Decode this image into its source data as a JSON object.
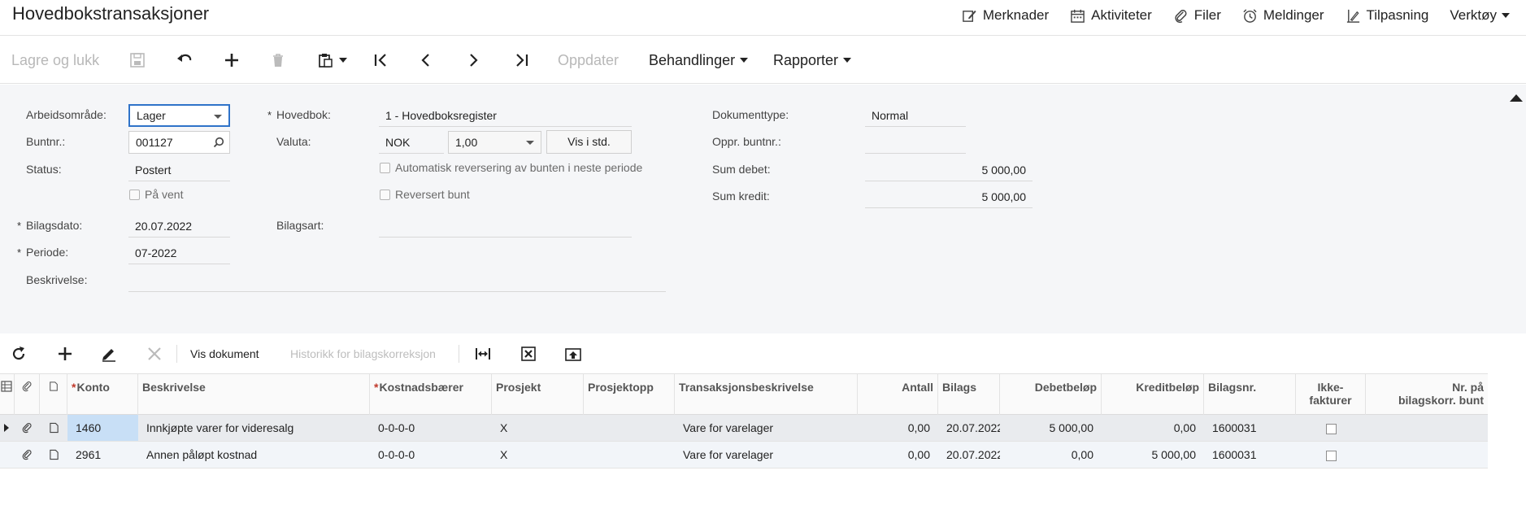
{
  "header": {
    "title": "Hovedbokstransaksjoner",
    "links": [
      {
        "label": "Merknader",
        "icon": "note-edit-icon"
      },
      {
        "label": "Aktiviteter",
        "icon": "calendar-icon"
      },
      {
        "label": "Filer",
        "icon": "paperclip-icon"
      },
      {
        "label": "Meldinger",
        "icon": "alarm-clock-icon"
      },
      {
        "label": "Tilpasning",
        "icon": "customize-icon"
      },
      {
        "label": "Verktøy",
        "icon": "chevron-down-icon"
      }
    ]
  },
  "toolbar": {
    "save_close": "Lagre og lukk",
    "update": "Oppdater",
    "actions": "Behandlinger",
    "reports": "Rapporter"
  },
  "form": {
    "workspace": {
      "label": "Arbeidsområde:",
      "value": "Lager"
    },
    "batch_no": {
      "label": "Buntnr.:",
      "value": "001127"
    },
    "status": {
      "label": "Status:",
      "value": "Postert"
    },
    "on_hold": {
      "label": "På vent"
    },
    "doc_date": {
      "label": "Bilagsdato:",
      "value": "20.07.2022"
    },
    "period": {
      "label": "Periode:",
      "value": "07-2022"
    },
    "description": {
      "label": "Beskrivelse:",
      "value": ""
    },
    "ledger": {
      "label": "Hovedbok:",
      "value": "1 - Hovedboksregister"
    },
    "currency": {
      "label": "Valuta:",
      "value": "NOK",
      "rate": "1,00",
      "button": "Vis i std."
    },
    "auto_reverse": {
      "label": "Automatisk reversering av bunten i neste periode"
    },
    "reversed_batch": {
      "label": "Reversert bunt"
    },
    "doc_type_field": {
      "label": "Bilagsart:",
      "value": ""
    },
    "document_type": {
      "label": "Dokumenttype:",
      "value": "Normal"
    },
    "orig_batch": {
      "label": "Oppr. buntnr.:",
      "value": ""
    },
    "sum_debit": {
      "label": "Sum debet:",
      "value": "5 000,00"
    },
    "sum_credit": {
      "label": "Sum kredit:",
      "value": "5 000,00"
    }
  },
  "grid_toolbar": {
    "view_document": "Vis dokument",
    "correction_history": "Historikk for bilagskorreksjon"
  },
  "grid": {
    "columns": {
      "account": "Konto",
      "description": "Beskrivelse",
      "cost_center": "Kostnadsbærer",
      "project": "Prosjekt",
      "project_task": "Prosjektopp",
      "trans_desc": "Transaksjonsbeskrivelse",
      "qty": "Antall",
      "doc_date": "Bilags",
      "debit": "Debetbeløp",
      "credit": "Kreditbeløp",
      "doc_no": "Bilagsnr.",
      "non_billable_1": "Ikke-",
      "non_billable_2": "fakturer",
      "corr_batch_1": "Nr. på",
      "corr_batch_2": "bilagskorr. bunt"
    },
    "rows": [
      {
        "account": "1460",
        "description": "Innkjøpte varer for videresalg",
        "cost_center": "0-0-0-0",
        "project": "X",
        "project_task": "",
        "trans_desc": "Vare for varelager",
        "qty": "0,00",
        "doc_date": "20.07.2022",
        "debit": "5 000,00",
        "credit": "0,00",
        "doc_no": "1600031"
      },
      {
        "account": "2961",
        "description": "Annen påløpt kostnad",
        "cost_center": "0-0-0-0",
        "project": "X",
        "project_task": "",
        "trans_desc": "Vare for varelager",
        "qty": "0,00",
        "doc_date": "20.07.2022",
        "debit": "0,00",
        "credit": "5 000,00",
        "doc_no": "1600031"
      }
    ]
  }
}
